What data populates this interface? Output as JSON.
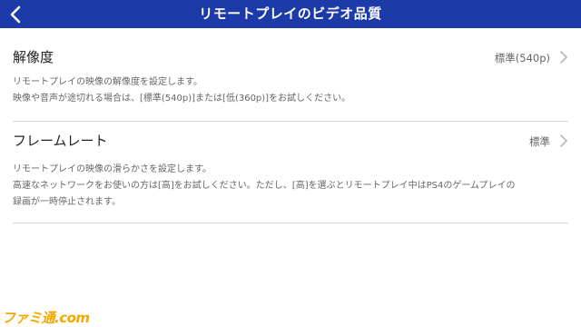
{
  "header": {
    "title": "リモートプレイのビデオ品質",
    "back_icon": "chevron-left-icon"
  },
  "settings": [
    {
      "title": "解像度",
      "value": "標準(540p)",
      "description": [
        "リモートプレイの映像の解像度を設定します。",
        "映像や音声が途切れる場合は、[標準(540p)]または[低(360p)]をお試しください。"
      ]
    },
    {
      "title": "フレームレート",
      "value": "標準",
      "description": [
        "リモートプレイの映像の滑らかさを設定します。",
        "高速なネットワークをお使いの方は[高]をお試しください。ただし、[高]を選ぶとリモートプレイ中はPS4のゲームプレイの",
        "録画が一時停止されます。"
      ]
    }
  ],
  "watermark": "ファミ通.com",
  "colors": {
    "header_bg": "#1c3aa8",
    "header_text": "#ffffff",
    "value_text": "#666666",
    "divider": "#d6d6d6"
  }
}
